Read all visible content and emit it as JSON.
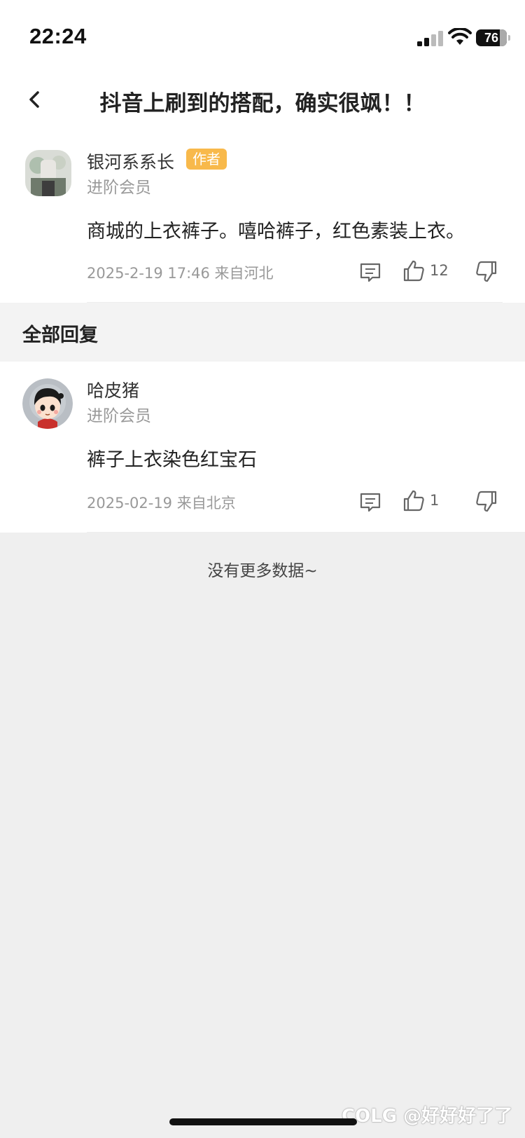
{
  "status_bar": {
    "time": "22:24",
    "battery": "76"
  },
  "header": {
    "title": "抖音上刷到的搭配，确实很飒！！"
  },
  "post": {
    "author": "银河系系长",
    "badge": "作者",
    "level": "进阶会员",
    "content": "商城的上衣裤子。嘻哈裤子，红色素装上衣。",
    "meta": "2025-2-19 17:46 来自河北",
    "likes": "12"
  },
  "section": {
    "title": "全部回复"
  },
  "reply": {
    "author": "哈皮猪",
    "level": "进阶会员",
    "content": "裤子上衣染色红宝石",
    "meta": "2025-02-19 来自北京",
    "likes": "1"
  },
  "footer": {
    "no_more": "没有更多数据~"
  },
  "watermark": "COLG @好好好了了"
}
